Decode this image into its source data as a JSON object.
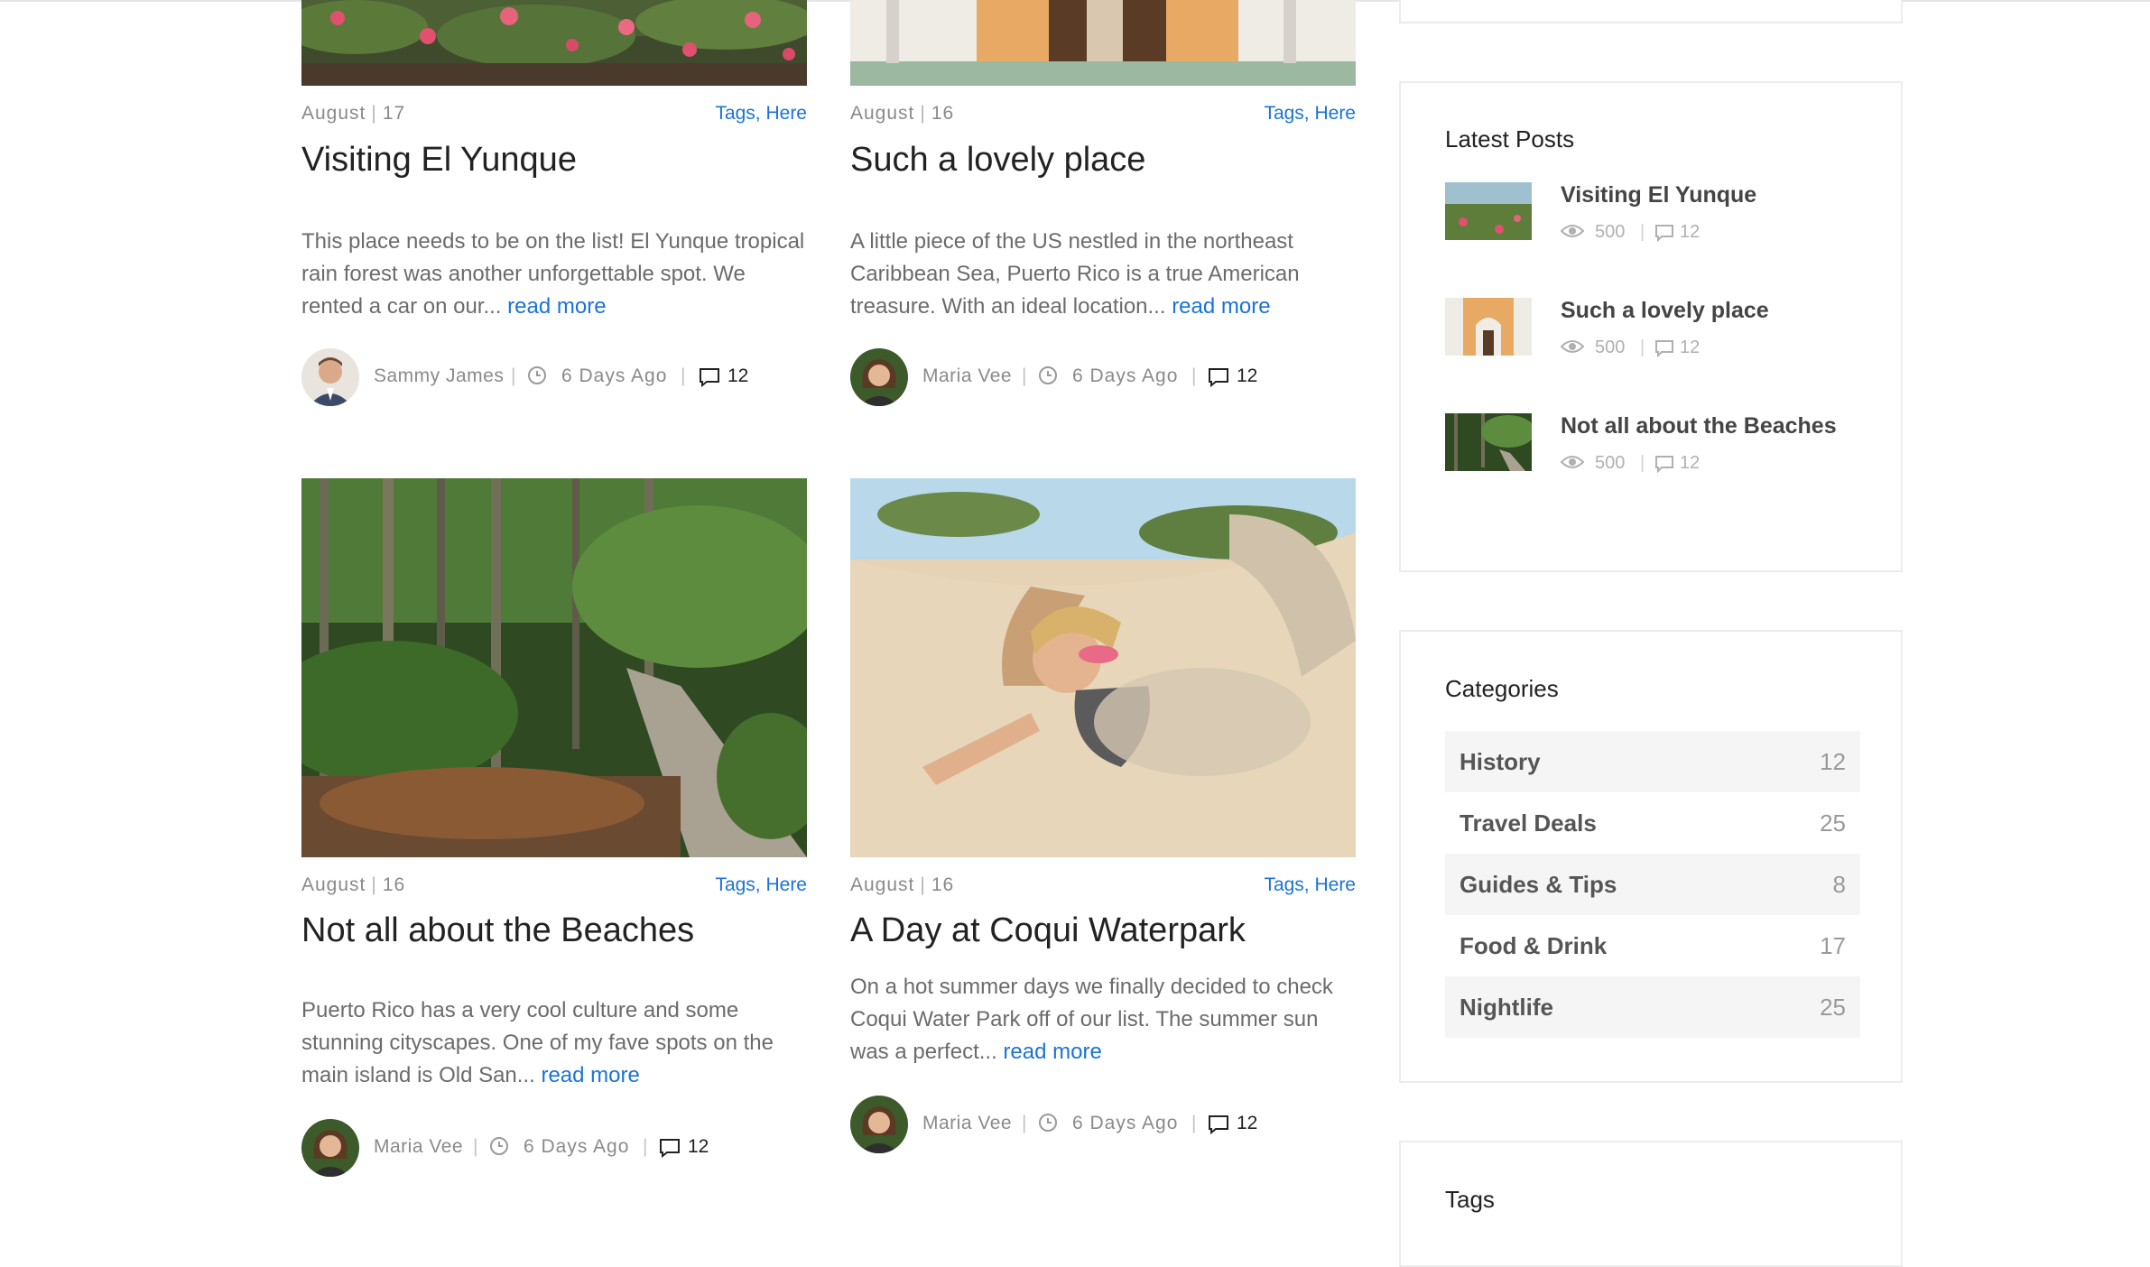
{
  "posts": [
    {
      "date_month": "August",
      "date_day": "17",
      "tags": [
        "Tags",
        "Here"
      ],
      "title": "Visiting El Yunque",
      "excerpt": "This place needs to be on the list! El Yunque tropical rain forest was another unforgettable spot. We rented a car on our...",
      "read_more": "read more",
      "author": "Sammy James",
      "ago": "6 Days Ago",
      "comments": "12"
    },
    {
      "date_month": "August",
      "date_day": "16",
      "tags": [
        "Tags",
        "Here"
      ],
      "title": "Such a lovely place",
      "excerpt": "A little piece of the US nestled in the northeast Caribbean Sea, Puerto Rico is a true American treasure. With an ideal location...",
      "read_more": "read more",
      "author": "Maria Vee",
      "ago": "6 Days Ago",
      "comments": "12"
    },
    {
      "date_month": "August",
      "date_day": "16",
      "tags": [
        "Tags",
        "Here"
      ],
      "title": "Not all about the Beaches",
      "excerpt": "Puerto Rico has a very cool culture and some stunning cityscapes. One of my fave spots on the main island is Old San...",
      "read_more": "read more",
      "author": "Maria Vee",
      "ago": "6 Days Ago",
      "comments": "12"
    },
    {
      "date_month": "August",
      "date_day": "16",
      "tags": [
        "Tags",
        "Here"
      ],
      "title": "A Day at Coqui Waterpark",
      "excerpt": "On a hot summer days we finally decided to check Coqui Water Park off of our list. The summer sun was a perfect...",
      "read_more": "read more",
      "author": "Maria Vee",
      "ago": "6 Days Ago",
      "comments": "12"
    }
  ],
  "latest_posts": {
    "title": "Latest Posts",
    "items": [
      {
        "name": "Visiting El Yunque",
        "views": "500",
        "comments": "12"
      },
      {
        "name": "Such a lovely place",
        "views": "500",
        "comments": "12"
      },
      {
        "name": "Not all about the Beaches",
        "views": "500",
        "comments": "12"
      }
    ]
  },
  "categories": {
    "title": "Categories",
    "items": [
      {
        "name": "History",
        "count": "12"
      },
      {
        "name": "Travel Deals",
        "count": "25"
      },
      {
        "name": "Guides & Tips",
        "count": "8"
      },
      {
        "name": "Food & Drink",
        "count": "17"
      },
      {
        "name": "Nightlife",
        "count": "25"
      }
    ]
  },
  "tags_widget": {
    "title": "Tags"
  },
  "colors": {
    "link": "#1a73d9",
    "title": "#222222",
    "muted": "#8a8a8a",
    "shade": "#f5f5f5",
    "border": "#ececec"
  },
  "icons": {
    "views": "eye-icon",
    "comments": "comment-icon",
    "time": "clock-icon"
  }
}
